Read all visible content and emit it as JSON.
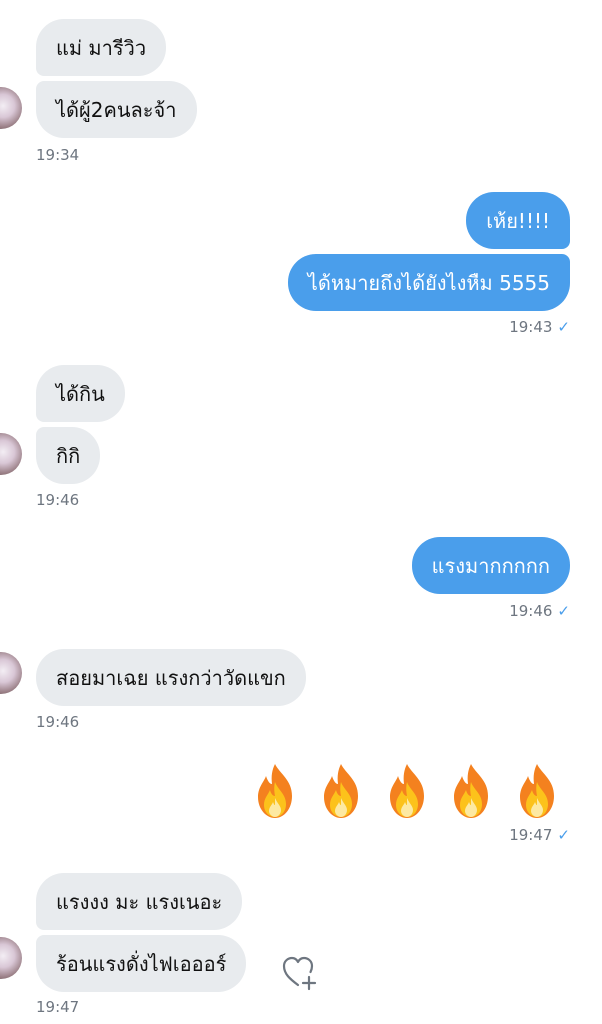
{
  "messages": [
    {
      "id": "m1",
      "dir": "in",
      "text": "แม่ มารีวิว"
    },
    {
      "id": "m2",
      "dir": "in",
      "text": "ได้ผู้2คนละจ้า"
    },
    {
      "id": "m3",
      "dir": "out",
      "text": "เห้ย!!!!"
    },
    {
      "id": "m4",
      "dir": "out",
      "text": "ได้หมายถึงได้ยังไงหืม 5555"
    },
    {
      "id": "m5",
      "dir": "in",
      "text": "ได้กิน"
    },
    {
      "id": "m6",
      "dir": "in",
      "text": "กิกิ"
    },
    {
      "id": "m7",
      "dir": "out",
      "text": "แรงมากกกกก"
    },
    {
      "id": "m8",
      "dir": "in",
      "text": "สอยมาเฉย แรงกว่าวัดแขก"
    },
    {
      "id": "m9",
      "dir": "in",
      "text": "แรงงง มะ แรงเนอะ"
    },
    {
      "id": "m10",
      "dir": "in",
      "text": "ร้อนแรงดั่งไฟเอออร์"
    }
  ],
  "timestamps": {
    "t1": "19:34",
    "t2": "19:43",
    "t3": "19:46",
    "t4": "19:46",
    "t5": "19:46",
    "t6": "19:47",
    "t7": "19:47"
  },
  "emoji_message": {
    "emoji": "fire",
    "count": 5
  },
  "read_mark": "✓",
  "icons": {
    "reaction": "heart-plus-icon",
    "avatar": "contact-avatar"
  },
  "colors": {
    "outgoing": "#4a9eeb",
    "incoming": "#e8ebee",
    "timestamp": "#6e7680"
  }
}
